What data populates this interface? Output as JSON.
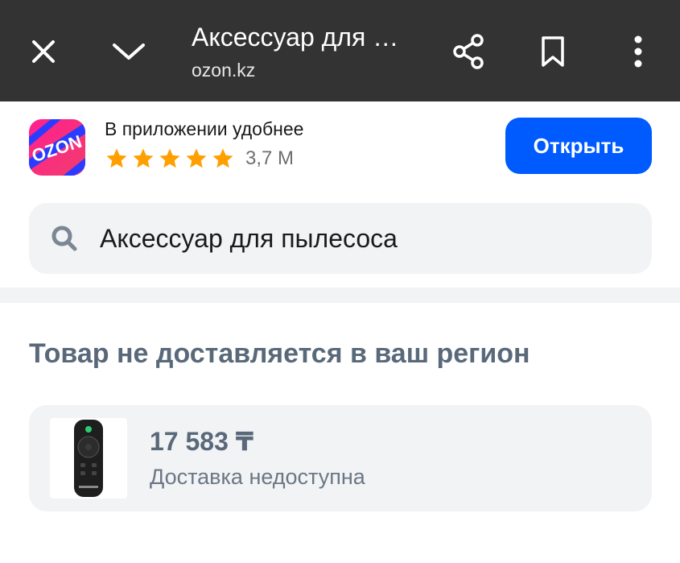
{
  "topbar": {
    "title": "Аксессуар для …",
    "url": "ozon.kz",
    "icons": [
      "close-icon",
      "chevron-down-icon",
      "share-icon",
      "bookmark-icon",
      "more-vert-icon"
    ]
  },
  "app_banner": {
    "logo_text": "OZON",
    "text": "В приложении удобнее",
    "rating_stars": 5,
    "rating_count": "3,7 M",
    "open_label": "Открыть",
    "colors": {
      "button": "#005bff",
      "star": "#ff9f00"
    }
  },
  "search": {
    "icon": "search-icon",
    "query": "Аксессуар для пылесоса"
  },
  "message": "Товар не доставляется в ваш регион",
  "product": {
    "price": "17 583 ₸",
    "delivery": "Доставка недоступна"
  }
}
